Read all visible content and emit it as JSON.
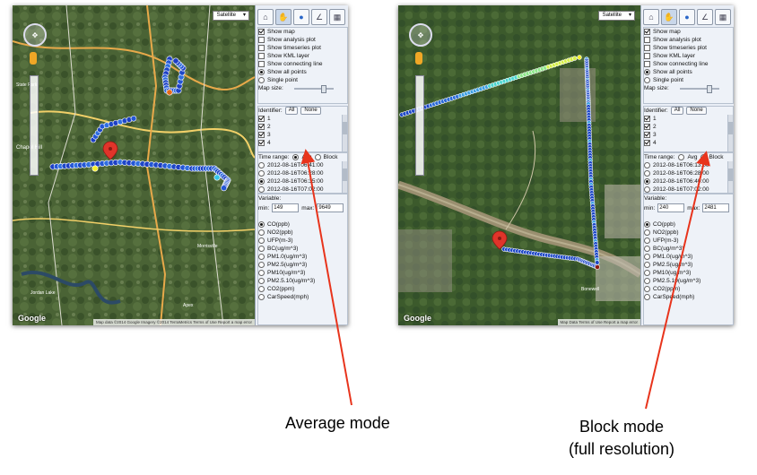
{
  "captions": {
    "average": "Average mode",
    "block_line1": "Block mode",
    "block_line2": "(full resolution)"
  },
  "colors": {
    "arrow": "#e8341c",
    "marker": "#e0342a",
    "track_low": "#1d47c7",
    "track_high": "#f7ef2a"
  },
  "icons": [
    "home-icon",
    "hand-icon",
    "marker-icon",
    "chart-icon",
    "table-icon"
  ],
  "panels": [
    {
      "map_type": "Satellite",
      "attribution": "Map data ©2014 Google Imagery ©2014 TerraMetrics   Terms of Use   Report a map error",
      "google": "Google",
      "places": [
        "State Park",
        "Chapel Hill",
        "Morrisville",
        "Jordan Lake",
        "Apex"
      ],
      "options": [
        {
          "label": "Show map",
          "checked": true
        },
        {
          "label": "Show analysis plot",
          "checked": false
        },
        {
          "label": "Show timeseries plot",
          "checked": false
        },
        {
          "label": "Show KML layer",
          "checked": false
        },
        {
          "label": "Show connecting line",
          "checked": false
        }
      ],
      "points_mode": [
        {
          "label": "Show all points",
          "selected": true
        },
        {
          "label": "Single point",
          "selected": false
        }
      ],
      "map_size_label": "Map size:",
      "identifier": {
        "label": "Identifier:",
        "all": "All",
        "none": "None",
        "items": [
          "1",
          "2",
          "3",
          "4"
        ],
        "checked": [
          true,
          true,
          true,
          true
        ]
      },
      "time_range": {
        "label": "Time range:",
        "avg": "Avg",
        "block": "Block",
        "mode": "avg",
        "items": [
          "2012-08-16T06:41:00",
          "2012-08-16T06:28:00",
          "2012-08-16T06:35:00",
          "2012-08-16T07:02:00"
        ],
        "selected": 2
      },
      "variable": {
        "label": "Variable:",
        "min_label": "min:",
        "min": "149",
        "max_label": "max:",
        "max": "9649",
        "items": [
          "CO(ppb)",
          "NO2(ppb)",
          "UFP(m-3)",
          "BC(ug/m^3)",
          "PM1.0(ug/m^3)",
          "PM2.5(ug/m^3)",
          "PM10(ug/m^3)",
          "PM2.5.10(ug/m^3)",
          "CO2(ppm)",
          "CarSpeed(mph)"
        ],
        "selected": 0
      }
    },
    {
      "map_type": "Satellite",
      "attribution": "Map Data   Terms of Use   Report a map error",
      "google": "Google",
      "places": [
        "Bonewell"
      ],
      "options": [
        {
          "label": "Show map",
          "checked": true
        },
        {
          "label": "Show analysis plot",
          "checked": false
        },
        {
          "label": "Show timeseries plot",
          "checked": false
        },
        {
          "label": "Show KML layer",
          "checked": false
        },
        {
          "label": "Show connecting line",
          "checked": false
        }
      ],
      "points_mode": [
        {
          "label": "Show all points",
          "selected": true
        },
        {
          "label": "Single point",
          "selected": false
        }
      ],
      "map_size_label": "Map size:",
      "identifier": {
        "label": "Identifier:",
        "all": "All",
        "none": "None",
        "items": [
          "1",
          "2",
          "3",
          "4"
        ],
        "checked": [
          true,
          true,
          true,
          true
        ]
      },
      "time_range": {
        "label": "Time range:",
        "avg": "Avg",
        "block": "Block",
        "mode": "block",
        "items": [
          "2012-08-16T06:13:00",
          "2012-08-16T06:28:00",
          "2012-08-16T06:40:00",
          "2012-08-16T07:02:00"
        ],
        "selected": 2
      },
      "variable": {
        "label": "Variable:",
        "min_label": "min:",
        "min": "240",
        "max_label": "max:",
        "max": "2481",
        "items": [
          "CO(ppb)",
          "NO2(ppb)",
          "UFP(m-3)",
          "BC(ug/m^3)",
          "PM1.0(ug/m^3)",
          "PM2.5(ug/m^3)",
          "PM10(ug/m^3)",
          "PM2.5.10(ug/m^3)",
          "CO2(ppm)",
          "CarSpeed(mph)"
        ],
        "selected": 0
      }
    }
  ]
}
